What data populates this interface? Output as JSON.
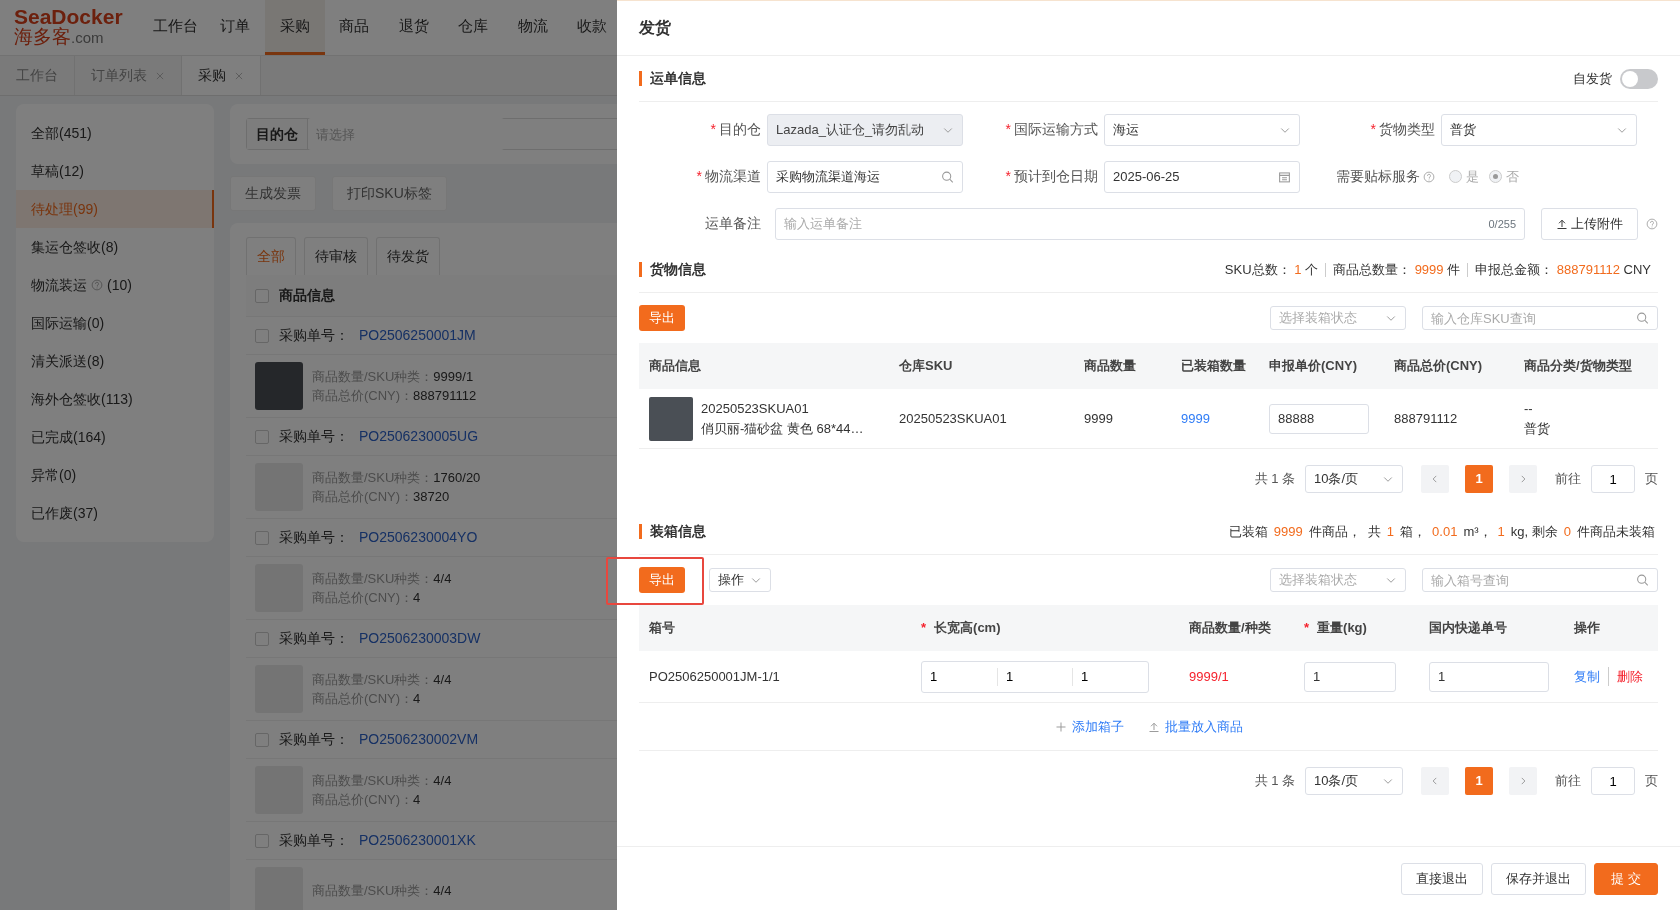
{
  "app": {
    "logo": {
      "brand": "SeaDocker",
      "name_cn": "海多客",
      "domain": ".com"
    },
    "nav": [
      {
        "label": "工作台",
        "selected": false
      },
      {
        "label": "订单",
        "selected": false
      },
      {
        "label": "采购",
        "selected": true
      },
      {
        "label": "商品",
        "selected": false
      },
      {
        "label": "退货",
        "selected": false
      },
      {
        "label": "仓库",
        "selected": false
      },
      {
        "label": "物流",
        "selected": false
      },
      {
        "label": "收款",
        "selected": false
      }
    ],
    "tabs": [
      {
        "label": "工作台",
        "closable": false,
        "selected": false
      },
      {
        "label": "订单列表",
        "closable": true,
        "selected": false
      },
      {
        "label": "采购",
        "closable": true,
        "selected": true
      }
    ],
    "sidebar": {
      "items": [
        {
          "label": "全部(451)",
          "help": false,
          "selected": false
        },
        {
          "label": "草稿(12)",
          "help": false,
          "selected": false
        },
        {
          "label": "待处理(99)",
          "help": false,
          "selected": true
        },
        {
          "label": "集运仓签收(8)",
          "help": false,
          "selected": false
        },
        {
          "label": "物流装运",
          "help": true,
          "count": "(10)",
          "selected": false
        },
        {
          "label": "国际运输(0)",
          "help": false,
          "selected": false
        },
        {
          "label": "清关派送(8)",
          "help": false,
          "selected": false
        },
        {
          "label": "海外仓签收(113)",
          "help": false,
          "selected": false
        },
        {
          "label": "已完成(164)",
          "help": false,
          "selected": false
        },
        {
          "label": "异常(0)",
          "help": false,
          "selected": false
        },
        {
          "label": "已作废(37)",
          "help": false,
          "selected": false
        }
      ]
    },
    "filter": {
      "label": "目的仓",
      "placeholder": "请选择"
    },
    "actions": [
      "生成发票",
      "打印SKU标签"
    ],
    "status_tabs": [
      {
        "label": "全部",
        "selected": true
      },
      {
        "label": "待审核",
        "selected": false
      },
      {
        "label": "待发货",
        "selected": false
      }
    ],
    "list": {
      "header": "商品信息",
      "all_checked": false,
      "orders": [
        {
          "checked": false,
          "order_label": "采购单号：",
          "order_no": "PO2506250001JM",
          "kind": "photo",
          "qty_label": "商品数量/SKU种类：",
          "qty": "9999/1",
          "total_label": "商品总价(CNY)：",
          "total": "888791112"
        },
        {
          "checked": false,
          "order_label": "采购单号：",
          "order_no": "PO2506230005UG",
          "kind": "placeholder",
          "qty_label": "商品数量/SKU种类：",
          "qty": "1760/20",
          "total_label": "商品总价(CNY)：",
          "total": "38720"
        },
        {
          "checked": false,
          "order_label": "采购单号：",
          "order_no": "PO2506230004YO",
          "kind": "placeholder",
          "qty_label": "商品数量/SKU种类：",
          "qty": "4/4",
          "total_label": "商品总价(CNY)：",
          "total": "4"
        },
        {
          "checked": false,
          "order_label": "采购单号：",
          "order_no": "PO2506230003DW",
          "kind": "placeholder",
          "qty_label": "商品数量/SKU种类：",
          "qty": "4/4",
          "total_label": "商品总价(CNY)：",
          "total": "4"
        },
        {
          "checked": false,
          "order_label": "采购单号：",
          "order_no": "PO2506230002VM",
          "kind": "placeholder",
          "qty_label": "商品数量/SKU种类：",
          "qty": "4/4",
          "total_label": "商品总价(CNY)：",
          "total": "4"
        },
        {
          "checked": false,
          "order_label": "采购单号：",
          "order_no": "PO2506230001XK",
          "kind": "placeholder",
          "qty_label": "商品数量/SKU种类：",
          "qty": "4/4"
        }
      ]
    }
  },
  "drawer": {
    "title": "发货",
    "waybill": {
      "title": "运单信息",
      "self_ship": {
        "label": "自发货",
        "on": false
      },
      "rows": [
        [
          {
            "kind": "select",
            "required_mark": "*",
            "label": "目的仓",
            "value": "Lazada_认证仓_请勿乱动",
            "disabled": true,
            "help": false
          },
          {
            "kind": "select",
            "required_mark": "*",
            "label": "国际运输方式",
            "value": "海运",
            "disabled": false,
            "help": false
          },
          {
            "kind": "select",
            "required_mark": "*",
            "label": "货物类型",
            "value": "普货",
            "disabled": false,
            "help": false
          }
        ],
        [
          {
            "kind": "search",
            "required_mark": "*",
            "label": "物流渠道",
            "value": "采购物流渠道海运",
            "disabled": false,
            "help": false
          },
          {
            "kind": "date",
            "required_mark": "*",
            "label": "预计到仓日期",
            "value": "2025-06-25",
            "disabled": false,
            "help": false
          },
          {
            "kind": "radio",
            "label": "需要贴标服务",
            "disabled": true,
            "help": true,
            "options": [
              {
                "label": "是",
                "selected": false
              },
              {
                "label": "否",
                "selected": true
              }
            ]
          }
        ],
        [
          {
            "kind": "note",
            "label": "运单备注",
            "placeholder": "输入运单备注",
            "counter": "0/255",
            "upload": "上传附件",
            "disabled": false,
            "help": true
          }
        ]
      ]
    },
    "goods": {
      "title": "货物信息",
      "summary": [
        {
          "label": "SKU总数：",
          "value": "1",
          "unit": "个"
        },
        {
          "label": "商品总数量：",
          "value": "9999",
          "unit": "件"
        },
        {
          "label": "申报总金额：",
          "value": "888791112",
          "unit": "CNY"
        }
      ],
      "export": "导出",
      "status_placeholder": "选择装箱状态",
      "search_placeholder": "输入仓库SKU查询",
      "columns": [
        "商品信息",
        "仓库SKU",
        "商品数量",
        "已装箱数量",
        "申报单价(CNY)",
        "商品总价(CNY)",
        "商品分类/货物类型"
      ],
      "rows": [
        {
          "sku": "20250523SKUA01",
          "name": "俏贝丽-猫砂盆 黄色 68*44…",
          "warehouse_sku": "20250523SKUA01",
          "qty": "9999",
          "packed": "9999",
          "price": "88888",
          "total": "888791112",
          "category": "--",
          "cargo_type": "普货"
        }
      ],
      "pagination": {
        "total": "共 1 条",
        "page_size": "10条/页",
        "pages": [
          {
            "label": "1",
            "selected": true
          }
        ],
        "goto_label": "前往",
        "goto_value": "1",
        "page_unit": "页"
      }
    },
    "packing": {
      "title": "装箱信息",
      "summary": [
        {
          "text": "已装箱",
          "accent": false
        },
        {
          "text": "9999",
          "accent": true
        },
        {
          "text": "件商品，  共",
          "accent": false
        },
        {
          "text": "1",
          "accent": true
        },
        {
          "text": "箱，",
          "accent": false
        },
        {
          "text": "0.01",
          "accent": true
        },
        {
          "text": "m³，",
          "accent": false
        },
        {
          "text": "1",
          "accent": true
        },
        {
          "text": "kg, 剩余",
          "accent": false
        },
        {
          "text": "0",
          "accent": true
        },
        {
          "text": "件商品未装箱",
          "accent": false
        }
      ],
      "export": "导出",
      "export_highlighted": true,
      "ops": "操作",
      "status_placeholder": "选择装箱状态",
      "search_placeholder": "输入箱号查询",
      "columns": [
        {
          "label": "箱号"
        },
        {
          "label": "长宽高(cm)",
          "required_mark": "*"
        },
        {
          "label": "商品数量/种类"
        },
        {
          "label": "重量(kg)",
          "required_mark": "*"
        },
        {
          "label": "国内快递单号"
        },
        {
          "label": "操作"
        }
      ],
      "rows": [
        {
          "box_no": "PO2506250001JM-1/1",
          "dims": [
            "1",
            "1",
            "1"
          ],
          "qty": "9999/1",
          "weight": "1",
          "tracking": "1",
          "actions": [
            {
              "label": "复制",
              "kind": "link"
            },
            {
              "label": "删除",
              "kind": "danger"
            }
          ]
        }
      ],
      "add_actions": [
        {
          "label": "添加箱子",
          "kind": "add"
        },
        {
          "label": "批量放入商品",
          "kind": "upload"
        }
      ],
      "pagination": {
        "total": "共 1 条",
        "page_size": "10条/页",
        "pages": [
          {
            "label": "1",
            "selected": true
          }
        ],
        "goto_label": "前往",
        "goto_value": "1",
        "page_unit": "页"
      }
    },
    "footer": [
      {
        "label": "直接退出",
        "kind": "secondary"
      },
      {
        "label": "保存并退出",
        "kind": "secondary"
      },
      {
        "label": "提 交",
        "kind": "primary"
      }
    ]
  }
}
